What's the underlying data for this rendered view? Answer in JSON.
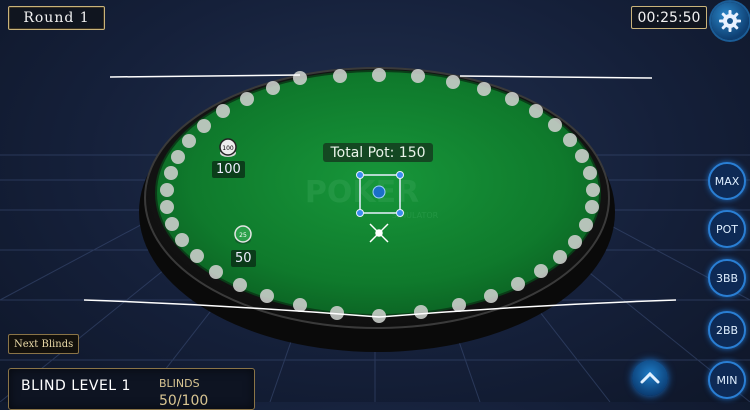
{
  "header": {
    "round_label": "Round 1",
    "timer": "00:25:50"
  },
  "table": {
    "pot_label": "Total Pot: 150",
    "watermark": "POKER",
    "watermark_sub": "SIMULATOR"
  },
  "players": [
    {
      "stack": "100",
      "chip_value": "100"
    },
    {
      "stack": "50",
      "chip_value": "25"
    }
  ],
  "bet_buttons": [
    {
      "label": "MAX"
    },
    {
      "label": "POT"
    },
    {
      "label": "3BB"
    },
    {
      "label": "2BB"
    },
    {
      "label": "MIN"
    }
  ],
  "blinds": {
    "next_label": "Next Blinds",
    "level_label": "BLIND LEVEL 1",
    "title": "BLINDS",
    "value": "50/100"
  },
  "icons": {
    "settings": "gear-icon",
    "expand": "chevron-up-icon"
  },
  "colors": {
    "felt": "#0f7a2c",
    "button_accent": "#2a7fd4",
    "gold_border": "#c9b37a"
  }
}
